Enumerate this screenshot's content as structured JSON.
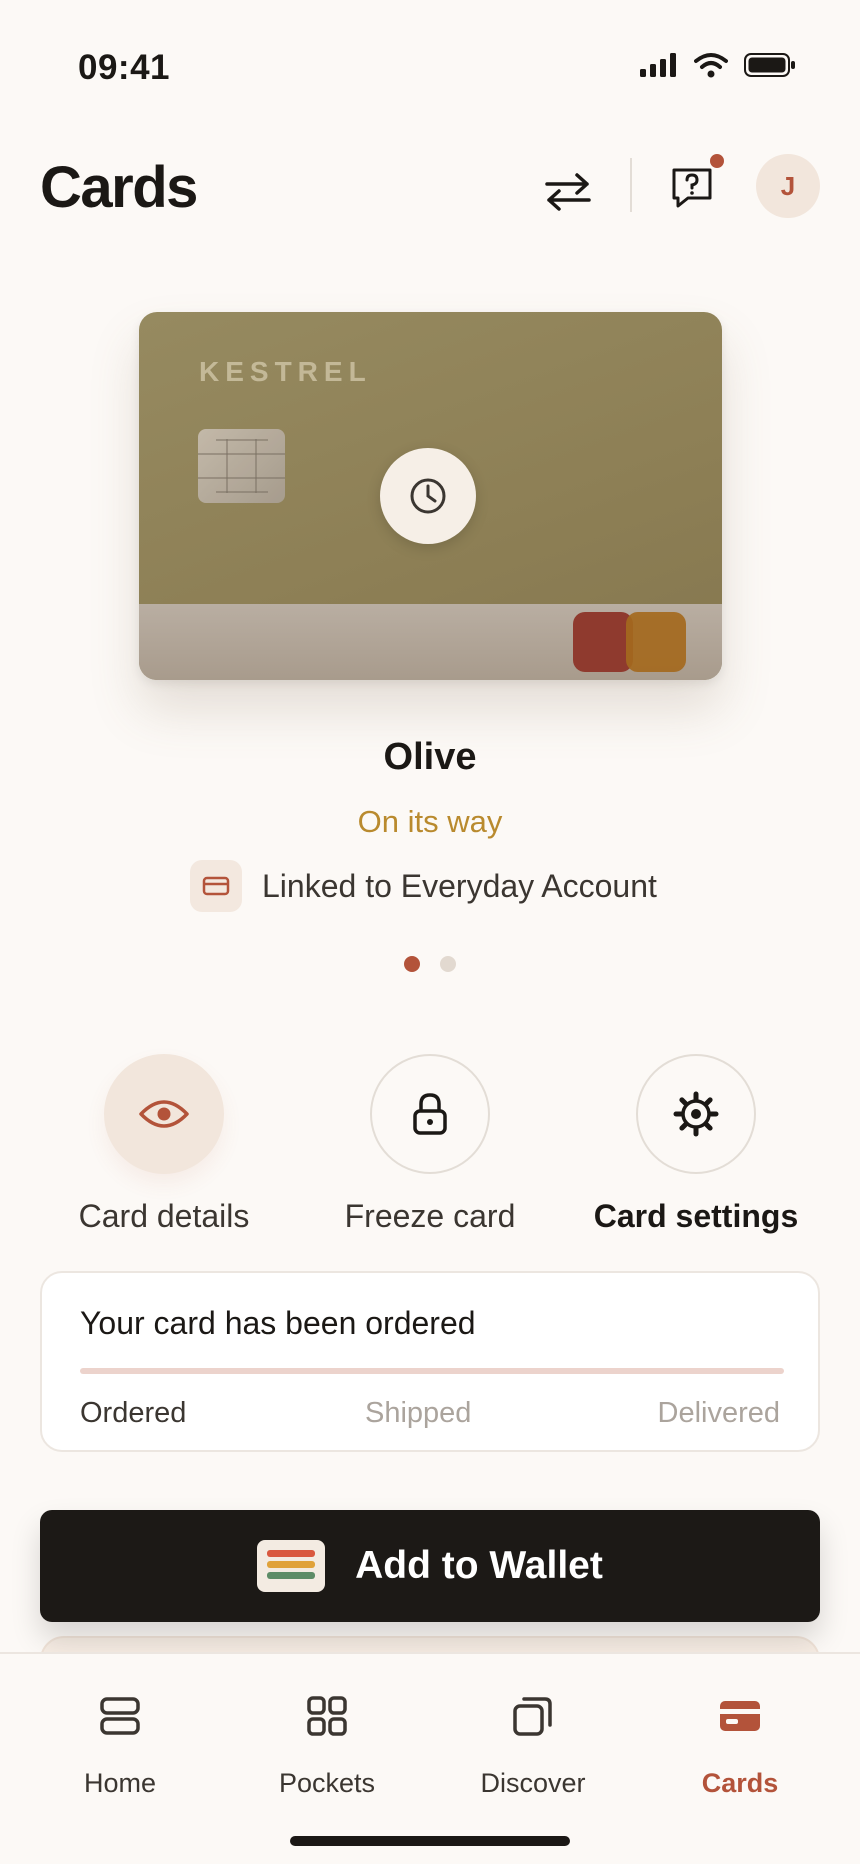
{
  "status_bar": {
    "time": "09:41"
  },
  "header": {
    "title": "Cards",
    "avatar_initial": "J"
  },
  "card": {
    "brand": "KESTREL",
    "name": "Olive",
    "state": "On its way",
    "linked_text": "Linked to Everyday Account",
    "pager": {
      "current": 1,
      "total": 2
    }
  },
  "actions": [
    {
      "label": "Card details",
      "icon": "eye-icon"
    },
    {
      "label": "Freeze card",
      "icon": "lock-icon"
    },
    {
      "label": "Card settings",
      "icon": "gear-icon"
    }
  ],
  "order": {
    "title": "Your card has been ordered",
    "progress": 0.0,
    "steps": [
      "Ordered",
      "Shipped",
      "Delivered"
    ]
  },
  "wallet_button": {
    "label": "Add to Wallet"
  },
  "tabs": [
    {
      "label": "Home",
      "icon": "home-icon"
    },
    {
      "label": "Pockets",
      "icon": "pockets-icon"
    },
    {
      "label": "Discover",
      "icon": "discover-icon"
    },
    {
      "label": "Cards",
      "icon": "cards-icon",
      "active": true
    }
  ],
  "colors": {
    "accent": "#b3533a",
    "status": "#b98a2e",
    "card": "#8f8257"
  }
}
